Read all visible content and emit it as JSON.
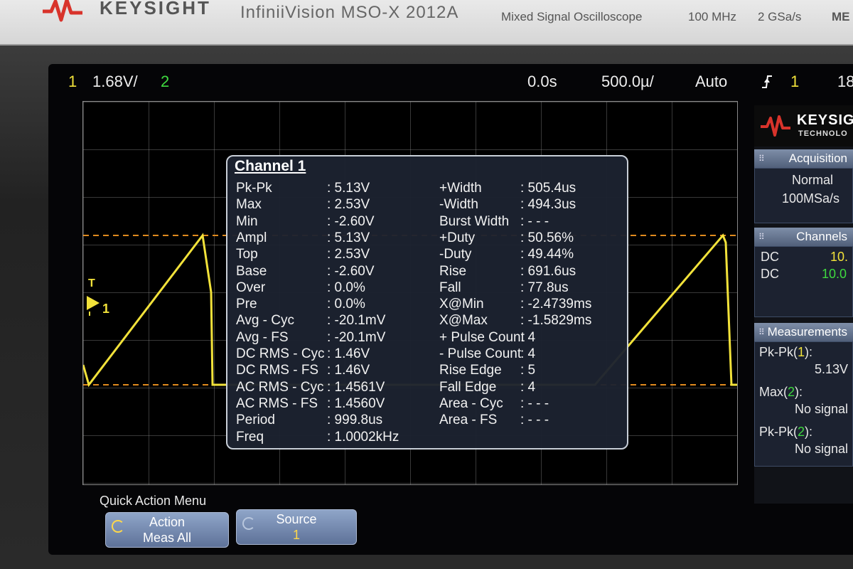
{
  "instrument": {
    "brand": "KEYSIGHT",
    "model": "InfiniiVision MSO-X 2012A",
    "description": "Mixed Signal Oscilloscope",
    "bandwidth": "100 MHz",
    "sample_rate": "2 GSa/s",
    "cut_label": "ME"
  },
  "topbar": {
    "ch1_num": "1",
    "ch1_scale": "1.68V/",
    "ch2_num": "2",
    "time_delay": "0.0s",
    "time_scale": "500.0µ/",
    "trigger_mode": "Auto",
    "trigger_icon": "rising-edge-icon",
    "trigger_source": "1",
    "trigger_level": "18"
  },
  "waveform": {
    "type": "sawtooth",
    "color": "#f2e23a",
    "cursor_color": "#e08a1e",
    "marker_label": "1",
    "trigger_marker": "T"
  },
  "measurements": {
    "title": "Channel 1",
    "left": [
      {
        "name": "Pk-Pk",
        "value": ": 5.13V"
      },
      {
        "name": "Max",
        "value": ": 2.53V"
      },
      {
        "name": "Min",
        "value": ": -2.60V"
      },
      {
        "name": "Ampl",
        "value": ": 5.13V"
      },
      {
        "name": "Top",
        "value": ": 2.53V"
      },
      {
        "name": "Base",
        "value": ": -2.60V"
      },
      {
        "name": "Over",
        "value": ": 0.0%"
      },
      {
        "name": "Pre",
        "value": ": 0.0%"
      },
      {
        "name": "Avg - Cyc",
        "value": ": -20.1mV"
      },
      {
        "name": "Avg - FS",
        "value": ": -20.1mV"
      },
      {
        "name": "DC RMS - Cyc",
        "value": ": 1.46V"
      },
      {
        "name": "DC RMS - FS",
        "value": ": 1.46V"
      },
      {
        "name": "AC RMS - Cyc",
        "value": ": 1.4561V"
      },
      {
        "name": "AC RMS - FS",
        "value": ": 1.4560V"
      },
      {
        "name": "Period",
        "value": ": 999.8us"
      },
      {
        "name": "Freq",
        "value": ": 1.0002kHz"
      }
    ],
    "right": [
      {
        "name": "+Width",
        "value": ": 505.4us"
      },
      {
        "name": "-Width",
        "value": ": 494.3us"
      },
      {
        "name": "Burst Width",
        "value": ": - - -"
      },
      {
        "name": "+Duty",
        "value": ": 50.56%"
      },
      {
        "name": "-Duty",
        "value": ": 49.44%"
      },
      {
        "name": "Rise",
        "value": ": 691.6us"
      },
      {
        "name": "Fall",
        "value": ": 77.8us"
      },
      {
        "name": "X@Min",
        "value": ": -2.4739ms"
      },
      {
        "name": "X@Max",
        "value": ": -1.5829ms"
      },
      {
        "name": "+ Pulse Count",
        "value": ": 4"
      },
      {
        "name": "- Pulse Count",
        "value": ": 4"
      },
      {
        "name": "Rise Edge",
        "value": ": 5"
      },
      {
        "name": "Fall Edge",
        "value": ": 4"
      },
      {
        "name": "Area - Cyc",
        "value": ": - - -"
      },
      {
        "name": "Area - FS",
        "value": ": - - -"
      }
    ]
  },
  "sidebar": {
    "logo_text": "KEYSIG",
    "logo_sub": "TECHNOLO",
    "acquisition": {
      "header": "Acquisition",
      "mode": "Normal",
      "rate": "100MSa/s"
    },
    "channels": {
      "header": "Channels",
      "rows": [
        {
          "coupling": "DC",
          "value": "10.",
          "color": "#f2e23a"
        },
        {
          "coupling": "DC",
          "value": "10.0",
          "color": "#3fd93f"
        }
      ]
    },
    "measurements": {
      "header": "Measurements",
      "items": [
        {
          "label": "Pk-Pk(",
          "ch": "1",
          "label_end": "):",
          "value": "5.13V",
          "ch_color": "#f2e23a"
        },
        {
          "label": "Max(",
          "ch": "2",
          "label_end": "):",
          "value": "No signal",
          "ch_color": "#3fd93f"
        },
        {
          "label": "Pk-Pk(",
          "ch": "2",
          "label_end": "):",
          "value": "No signal",
          "ch_color": "#3fd93f"
        }
      ]
    }
  },
  "quick_action": {
    "title": "Quick Action Menu",
    "buttons": [
      {
        "line1": "Action",
        "line2": "Meas All",
        "icon": "back-arrow-icon"
      },
      {
        "line1": "Source",
        "line2": "1",
        "icon": "back-arrow-icon"
      }
    ]
  }
}
